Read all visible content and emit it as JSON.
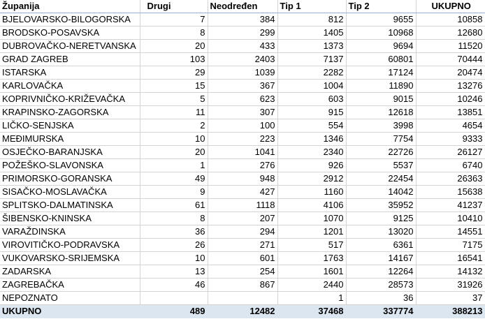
{
  "header": {
    "zupanija": "Županija",
    "drugi": "Drugi",
    "neodredjen": "Neodređen",
    "tip1": "Tip 1",
    "tip2": "Tip 2",
    "ukupno": "UKUPNO"
  },
  "rows": [
    {
      "name": "BJELOVARSKO-BILOGORSKA",
      "drugi": "7",
      "neodredjen": "384",
      "tip1": "812",
      "tip2": "9655",
      "ukupno": "10858"
    },
    {
      "name": "BRODSKO-POSAVSKA",
      "drugi": "8",
      "neodredjen": "299",
      "tip1": "1405",
      "tip2": "10968",
      "ukupno": "12680"
    },
    {
      "name": "DUBROVAČKO-NERETVANSKA",
      "drugi": "20",
      "neodredjen": "433",
      "tip1": "1373",
      "tip2": "9694",
      "ukupno": "11520"
    },
    {
      "name": "GRAD ZAGREB",
      "drugi": "103",
      "neodredjen": "2403",
      "tip1": "7137",
      "tip2": "60801",
      "ukupno": "70444"
    },
    {
      "name": "ISTARSKA",
      "drugi": "29",
      "neodredjen": "1039",
      "tip1": "2282",
      "tip2": "17124",
      "ukupno": "20474"
    },
    {
      "name": "KARLOVAČKA",
      "drugi": "15",
      "neodredjen": "367",
      "tip1": "1004",
      "tip2": "11890",
      "ukupno": "13276"
    },
    {
      "name": "KOPRIVNIČKO-KRIŽEVAČKA",
      "drugi": "5",
      "neodredjen": "623",
      "tip1": "603",
      "tip2": "9015",
      "ukupno": "10246"
    },
    {
      "name": "KRAPINSKO-ZAGORSKA",
      "drugi": "11",
      "neodredjen": "307",
      "tip1": "915",
      "tip2": "12618",
      "ukupno": "13851"
    },
    {
      "name": "LIČKO-SENJSKA",
      "drugi": "2",
      "neodredjen": "100",
      "tip1": "554",
      "tip2": "3998",
      "ukupno": "4654"
    },
    {
      "name": "MEĐIMURSKA",
      "drugi": "10",
      "neodredjen": "223",
      "tip1": "1346",
      "tip2": "7754",
      "ukupno": "9333"
    },
    {
      "name": "OSJEČKO-BARANJSKA",
      "drugi": "20",
      "neodredjen": "1041",
      "tip1": "2340",
      "tip2": "22726",
      "ukupno": "26127"
    },
    {
      "name": "POŽEŠKO-SLAVONSKA",
      "drugi": "1",
      "neodredjen": "276",
      "tip1": "926",
      "tip2": "5537",
      "ukupno": "6740"
    },
    {
      "name": "PRIMORSKO-GORANSKA",
      "drugi": "49",
      "neodredjen": "948",
      "tip1": "2912",
      "tip2": "22454",
      "ukupno": "26363"
    },
    {
      "name": "SISAČKO-MOSLAVAČKA",
      "drugi": "9",
      "neodredjen": "427",
      "tip1": "1160",
      "tip2": "14042",
      "ukupno": "15638"
    },
    {
      "name": "SPLITSKO-DALMATINSKA",
      "drugi": "61",
      "neodredjen": "1118",
      "tip1": "4106",
      "tip2": "35952",
      "ukupno": "41237"
    },
    {
      "name": "ŠIBENSKO-KNINSKA",
      "drugi": "8",
      "neodredjen": "207",
      "tip1": "1070",
      "tip2": "9125",
      "ukupno": "10410"
    },
    {
      "name": "VARAŽDINSKA",
      "drugi": "36",
      "neodredjen": "294",
      "tip1": "1201",
      "tip2": "13020",
      "ukupno": "14551"
    },
    {
      "name": "VIROVITIČKO-PODRAVSKA",
      "drugi": "26",
      "neodredjen": "271",
      "tip1": "517",
      "tip2": "6361",
      "ukupno": "7175"
    },
    {
      "name": "VUKOVARSKO-SRIJEMSKA",
      "drugi": "10",
      "neodredjen": "601",
      "tip1": "1763",
      "tip2": "14167",
      "ukupno": "16541"
    },
    {
      "name": "ZADARSKA",
      "drugi": "13",
      "neodredjen": "254",
      "tip1": "1601",
      "tip2": "12264",
      "ukupno": "14132"
    },
    {
      "name": "ZAGREBAČKA",
      "drugi": "46",
      "neodredjen": "867",
      "tip1": "2440",
      "tip2": "28573",
      "ukupno": "31926"
    },
    {
      "name": "NEPOZNATO",
      "drugi": "",
      "neodredjen": "",
      "tip1": "1",
      "tip2": "36",
      "ukupno": "37"
    }
  ],
  "total": {
    "name": "UKUPNO",
    "drugi": "489",
    "neodredjen": "12482",
    "tip1": "37468",
    "tip2": "337774",
    "ukupno": "388213"
  }
}
